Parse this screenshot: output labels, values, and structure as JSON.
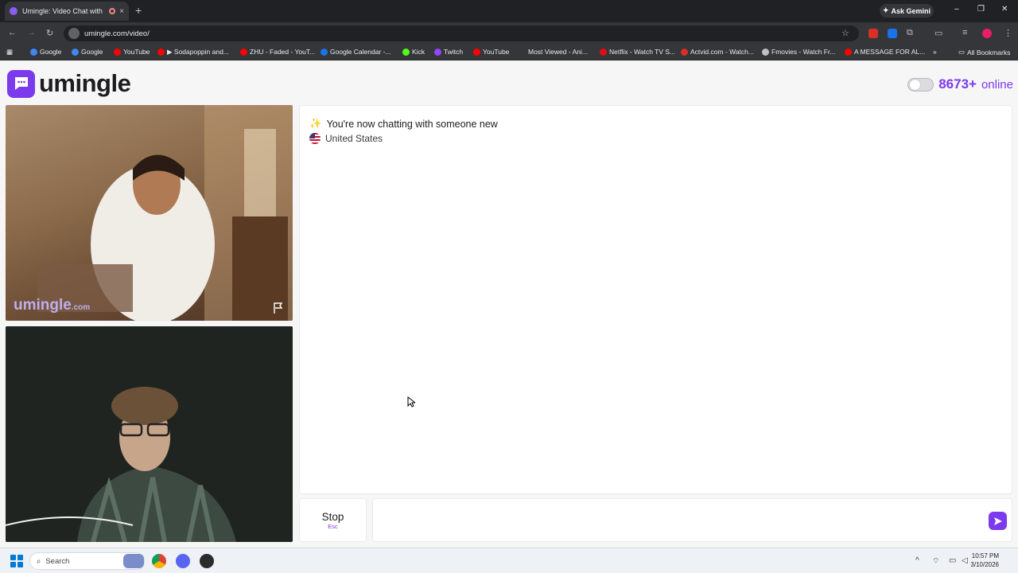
{
  "browser": {
    "tab_title": "Umingle: Video Chat with S",
    "tab_close": "×",
    "new_tab": "+",
    "gemini_label": "Ask Gemini",
    "url": "umingle.com/video/",
    "window_controls": [
      "–",
      "❐",
      "✕"
    ]
  },
  "bookmarks": {
    "items": [
      {
        "label": "Google",
        "color": "#4285f4"
      },
      {
        "label": "Google",
        "color": "#4285f4"
      },
      {
        "label": "YouTube",
        "color": "#ff0000"
      },
      {
        "label": "▶ Sodapoppin and...",
        "color": "#ff0000"
      },
      {
        "label": "ZHU - Faded - YouT...",
        "color": "#ff0000"
      },
      {
        "label": "Google Calendar -...",
        "color": "#1a73e8"
      },
      {
        "label": "Kick",
        "color": "#53fc18"
      },
      {
        "label": "Twitch",
        "color": "#9146ff"
      },
      {
        "label": "YouTube",
        "color": "#ff0000"
      },
      {
        "label": "Most Viewed - Ani...",
        "color": "#35363a"
      },
      {
        "label": "Netflix - Watch TV S...",
        "color": "#e50914"
      },
      {
        "label": "Actvid.com - Watch...",
        "color": "#d93025"
      },
      {
        "label": "Fmovies - Watch Fr...",
        "color": "#bdc1c6"
      },
      {
        "label": "A MESSAGE FOR AL...",
        "color": "#ff0000"
      }
    ],
    "more": "»",
    "all_bookmarks": "All Bookmarks"
  },
  "site": {
    "brand": "umingle",
    "online_count": "8673+",
    "online_label": "online",
    "accent_color": "#7c3aed"
  },
  "video": {
    "watermark": "umingle",
    "watermark_suffix": ".com"
  },
  "chat": {
    "status_message": "You're now chatting with someone new",
    "status_emoji": "✨",
    "country": "United States"
  },
  "controls": {
    "stop_label": "Stop",
    "stop_shortcut": "Esc",
    "message_value": ""
  },
  "taskbar": {
    "search_placeholder": "Search",
    "time": "10:57 PM",
    "date": "3/10/2026"
  }
}
